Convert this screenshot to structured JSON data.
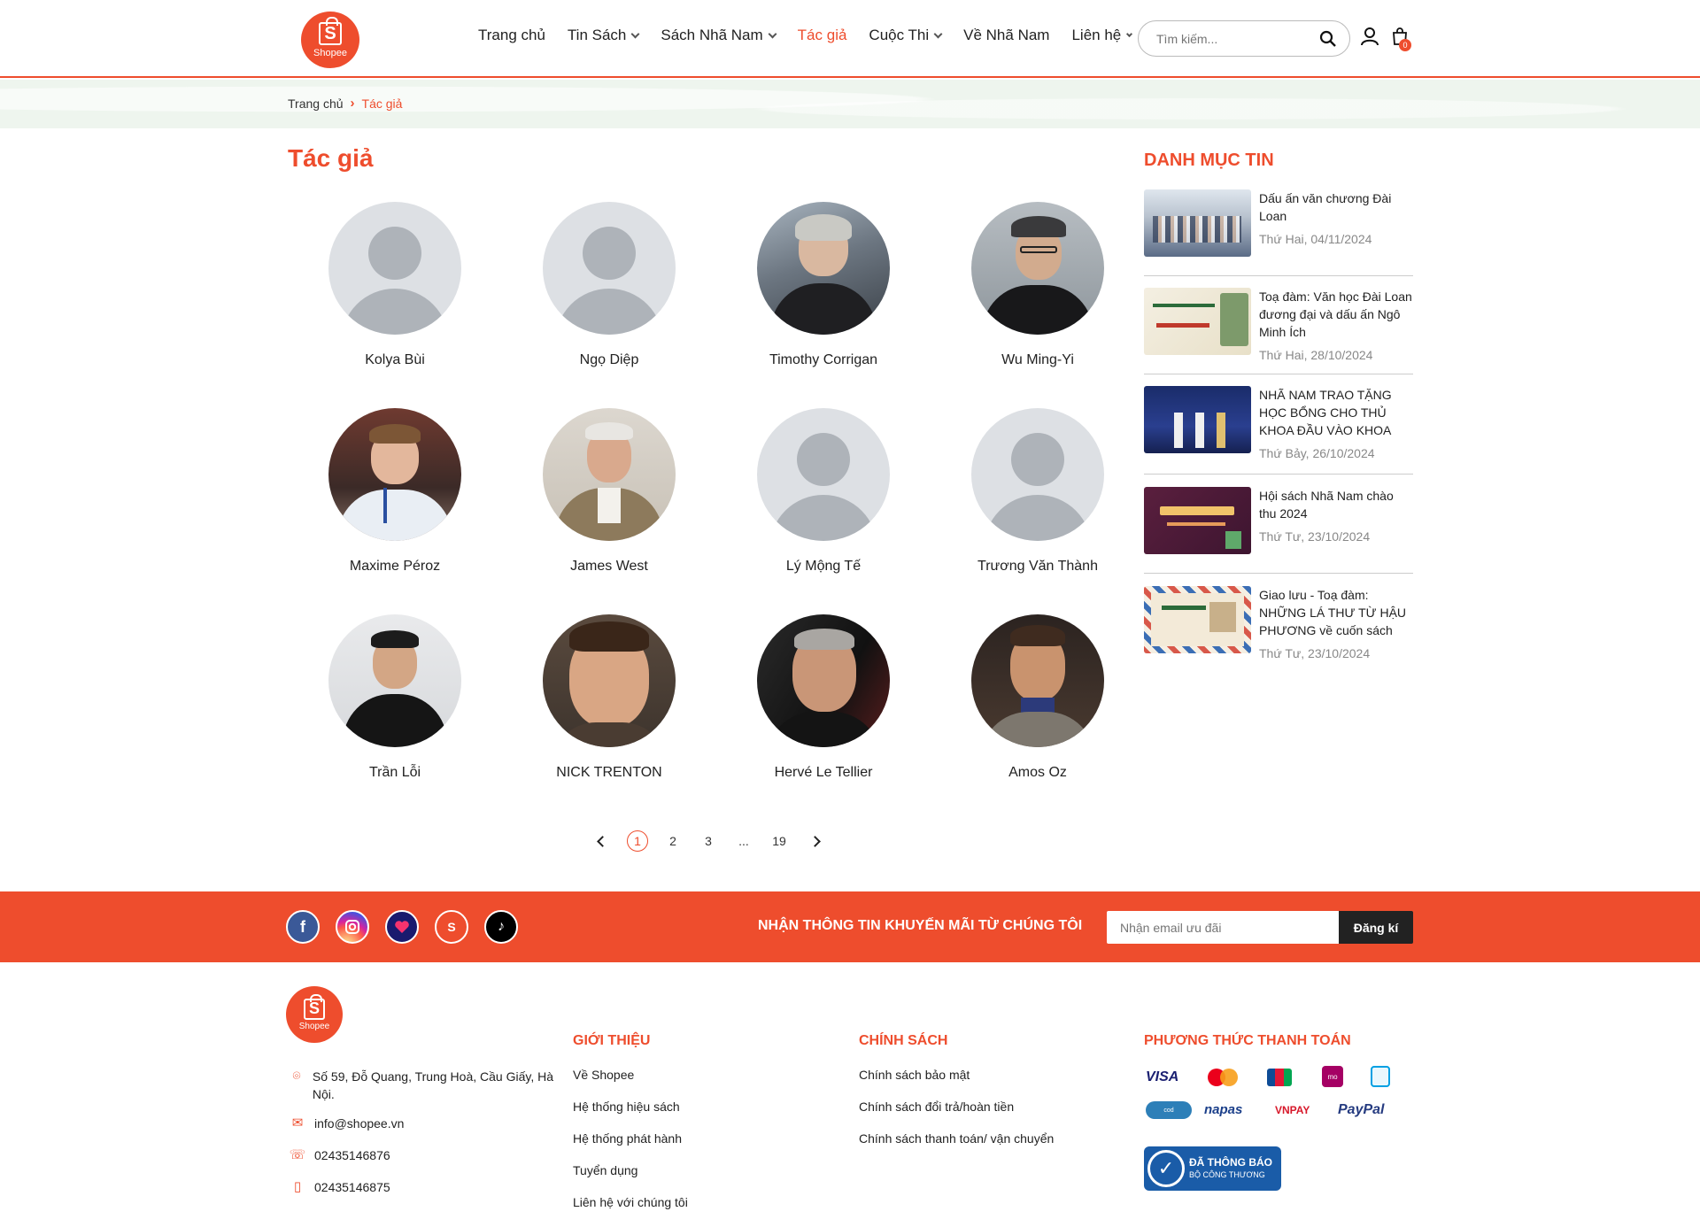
{
  "header": {
    "logo_text": "Shopee",
    "nav": [
      {
        "label": "Trang chủ",
        "dropdown": false,
        "active": false
      },
      {
        "label": "Tin Sách",
        "dropdown": true,
        "active": false
      },
      {
        "label": "Sách Nhã Nam",
        "dropdown": true,
        "active": false
      },
      {
        "label": "Tác giả",
        "dropdown": false,
        "active": true
      },
      {
        "label": "Cuộc Thi",
        "dropdown": true,
        "active": false
      },
      {
        "label": "Về Nhã Nam",
        "dropdown": false,
        "active": false
      },
      {
        "label": "Liên hệ",
        "dropdown": true,
        "active": false
      }
    ],
    "search_placeholder": "Tìm kiếm...",
    "cart_count": "0"
  },
  "breadcrumb": {
    "home": "Trang chủ",
    "current": "Tác giả"
  },
  "main": {
    "title": "Tác giả",
    "authors": [
      {
        "name": "Kolya Bùi",
        "photo": "placeholder"
      },
      {
        "name": "Ngọ Diệp",
        "photo": "placeholder"
      },
      {
        "name": "Timothy Corrigan",
        "photo": "photo"
      },
      {
        "name": "Wu Ming-Yi",
        "photo": "photo"
      },
      {
        "name": "Maxime Péroz",
        "photo": "photo"
      },
      {
        "name": "James West",
        "photo": "photo"
      },
      {
        "name": "Lý Mộng Tế",
        "photo": "placeholder"
      },
      {
        "name": "Trương Văn Thành",
        "photo": "placeholder"
      },
      {
        "name": "Trần Lỗi",
        "photo": "photo"
      },
      {
        "name": "NICK TRENTON",
        "photo": "photo"
      },
      {
        "name": "Hervé Le Tellier",
        "photo": "photo"
      },
      {
        "name": "Amos Oz",
        "photo": "photo"
      }
    ],
    "pagination": {
      "pages": [
        "1",
        "2",
        "3",
        "...",
        "19"
      ],
      "current": "1"
    }
  },
  "sidebar": {
    "title": "DANH MỤC TIN",
    "news": [
      {
        "title": "Dấu ấn văn chương Đài Loan",
        "date": "Thứ Hai, 04/11/2024"
      },
      {
        "title": "Toạ đàm: Văn học Đài Loan đương đại và dấu ấn Ngô Minh Ích",
        "date": "Thứ Hai, 28/10/2024"
      },
      {
        "title": "NHÃ NAM TRAO TẶNG HỌC BỔNG CHO THỦ KHOA ĐẦU VÀO KHOA",
        "date": "Thứ Bảy, 26/10/2024"
      },
      {
        "title": "Hội sách Nhã Nam chào thu 2024",
        "date": "Thứ Tư, 23/10/2024"
      },
      {
        "title": "Giao lưu - Toạ đàm: NHỮNG LÁ THƯ TỪ HẬU PHƯƠNG về cuốn sách",
        "date": "Thứ Tư, 23/10/2024"
      }
    ]
  },
  "newsletter": {
    "title": "NHẬN THÔNG TIN KHUYẾN MÃI TỪ CHÚNG TÔI",
    "placeholder": "Nhận email ưu đãi",
    "button": "Đăng kí"
  },
  "footer": {
    "logo_text": "Shopee",
    "address": "Số 59, Đỗ Quang, Trung Hoà, Cầu Giấy, Hà Nội.",
    "email": "info@shopee.vn",
    "phone": "02435146876",
    "mobile": "02435146875",
    "intro_title": "GIỚI THIỆU",
    "intro_links": [
      "Về Shopee",
      "Hệ thống hiệu sách",
      "Hệ thống phát hành",
      "Tuyển dụng",
      "Liên hệ với chúng tôi"
    ],
    "policy_title": "CHÍNH SÁCH",
    "policy_links": [
      "Chính sách bảo mật",
      "Chính sách đổi trả/hoàn tiền",
      "Chính sách thanh toán/ vận chuyển"
    ],
    "payment_title": "PHƯƠNG THỨC THANH TOÁN",
    "payment_methods": [
      "VISA",
      "mastercard",
      "JCB",
      "momo",
      "zalopay",
      "cash on delivery",
      "napas",
      "VNPAY",
      "PayPal"
    ],
    "cert_line1": "ĐÃ THÔNG BÁO",
    "cert_line2": "BỘ CÔNG THƯƠNG"
  },
  "colors": {
    "accent": "#ee4d2d",
    "dark": "#222222"
  }
}
